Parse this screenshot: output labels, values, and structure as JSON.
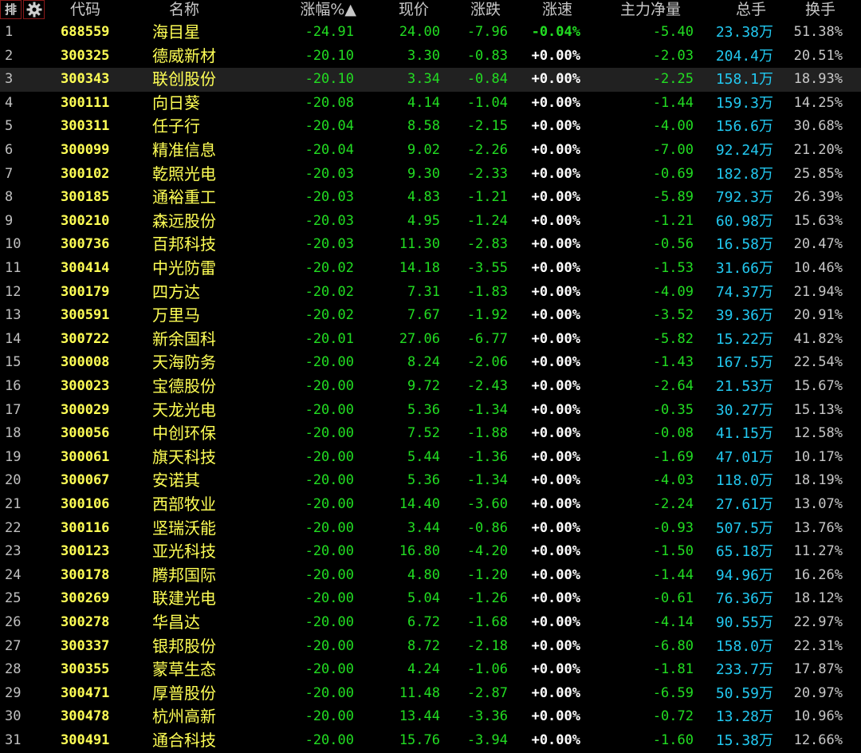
{
  "header": {
    "rank_icon_label": "排",
    "settings_icon": "gear-icon",
    "columns": [
      "代码",
      "名称",
      "涨幅%",
      "现价",
      "涨跌",
      "涨速",
      "主力净量",
      "总手",
      "换手"
    ],
    "sort_indicator": "▲"
  },
  "colors": {
    "background": "#000000",
    "code": "#ffff55",
    "name": "#ffff55",
    "down": "#22dd22",
    "volume": "#22c8f0",
    "speed": "#ffffff",
    "selected_row": "#212121"
  },
  "selected_row_index": 2,
  "rows": [
    {
      "idx": "1",
      "code": "688559",
      "name": "海目星",
      "pct": "-24.91",
      "price": "24.00",
      "chg": "-7.96",
      "speed": "-0.04%",
      "net": "-5.40",
      "vol": "23.38",
      "vol_unit": "万",
      "turn": "51.38%"
    },
    {
      "idx": "2",
      "code": "300325",
      "name": "德威新材",
      "pct": "-20.10",
      "price": "3.30",
      "chg": "-0.83",
      "speed": "+0.00%",
      "net": "-2.03",
      "vol": "204.4",
      "vol_unit": "万",
      "turn": "20.51%"
    },
    {
      "idx": "3",
      "code": "300343",
      "name": "联创股份",
      "pct": "-20.10",
      "price": "3.34",
      "chg": "-0.84",
      "speed": "+0.00%",
      "net": "-2.25",
      "vol": "158.1",
      "vol_unit": "万",
      "turn": "18.93%"
    },
    {
      "idx": "4",
      "code": "300111",
      "name": "向日葵",
      "pct": "-20.08",
      "price": "4.14",
      "chg": "-1.04",
      "speed": "+0.00%",
      "net": "-1.44",
      "vol": "159.3",
      "vol_unit": "万",
      "turn": "14.25%"
    },
    {
      "idx": "5",
      "code": "300311",
      "name": "任子行",
      "pct": "-20.04",
      "price": "8.58",
      "chg": "-2.15",
      "speed": "+0.00%",
      "net": "-4.00",
      "vol": "156.6",
      "vol_unit": "万",
      "turn": "30.68%"
    },
    {
      "idx": "6",
      "code": "300099",
      "name": "精准信息",
      "pct": "-20.04",
      "price": "9.02",
      "chg": "-2.26",
      "speed": "+0.00%",
      "net": "-7.00",
      "vol": "92.24",
      "vol_unit": "万",
      "turn": "21.20%"
    },
    {
      "idx": "7",
      "code": "300102",
      "name": "乾照光电",
      "pct": "-20.03",
      "price": "9.30",
      "chg": "-2.33",
      "speed": "+0.00%",
      "net": "-0.69",
      "vol": "182.8",
      "vol_unit": "万",
      "turn": "25.85%"
    },
    {
      "idx": "8",
      "code": "300185",
      "name": "通裕重工",
      "pct": "-20.03",
      "price": "4.83",
      "chg": "-1.21",
      "speed": "+0.00%",
      "net": "-5.89",
      "vol": "792.3",
      "vol_unit": "万",
      "turn": "26.39%"
    },
    {
      "idx": "9",
      "code": "300210",
      "name": "森远股份",
      "pct": "-20.03",
      "price": "4.95",
      "chg": "-1.24",
      "speed": "+0.00%",
      "net": "-1.21",
      "vol": "60.98",
      "vol_unit": "万",
      "turn": "15.63%"
    },
    {
      "idx": "10",
      "code": "300736",
      "name": "百邦科技",
      "pct": "-20.03",
      "price": "11.30",
      "chg": "-2.83",
      "speed": "+0.00%",
      "net": "-0.56",
      "vol": "16.58",
      "vol_unit": "万",
      "turn": "20.47%"
    },
    {
      "idx": "11",
      "code": "300414",
      "name": "中光防雷",
      "pct": "-20.02",
      "price": "14.18",
      "chg": "-3.55",
      "speed": "+0.00%",
      "net": "-1.53",
      "vol": "31.66",
      "vol_unit": "万",
      "turn": "10.46%"
    },
    {
      "idx": "12",
      "code": "300179",
      "name": "四方达",
      "pct": "-20.02",
      "price": "7.31",
      "chg": "-1.83",
      "speed": "+0.00%",
      "net": "-4.09",
      "vol": "74.37",
      "vol_unit": "万",
      "turn": "21.94%"
    },
    {
      "idx": "13",
      "code": "300591",
      "name": "万里马",
      "pct": "-20.02",
      "price": "7.67",
      "chg": "-1.92",
      "speed": "+0.00%",
      "net": "-3.52",
      "vol": "39.36",
      "vol_unit": "万",
      "turn": "20.91%"
    },
    {
      "idx": "14",
      "code": "300722",
      "name": "新余国科",
      "pct": "-20.01",
      "price": "27.06",
      "chg": "-6.77",
      "speed": "+0.00%",
      "net": "-5.82",
      "vol": "15.22",
      "vol_unit": "万",
      "turn": "41.82%"
    },
    {
      "idx": "15",
      "code": "300008",
      "name": "天海防务",
      "pct": "-20.00",
      "price": "8.24",
      "chg": "-2.06",
      "speed": "+0.00%",
      "net": "-1.43",
      "vol": "167.5",
      "vol_unit": "万",
      "turn": "22.54%"
    },
    {
      "idx": "16",
      "code": "300023",
      "name": "宝德股份",
      "pct": "-20.00",
      "price": "9.72",
      "chg": "-2.43",
      "speed": "+0.00%",
      "net": "-2.64",
      "vol": "21.53",
      "vol_unit": "万",
      "turn": "15.67%"
    },
    {
      "idx": "17",
      "code": "300029",
      "name": "天龙光电",
      "pct": "-20.00",
      "price": "5.36",
      "chg": "-1.34",
      "speed": "+0.00%",
      "net": "-0.35",
      "vol": "30.27",
      "vol_unit": "万",
      "turn": "15.13%"
    },
    {
      "idx": "18",
      "code": "300056",
      "name": "中创环保",
      "pct": "-20.00",
      "price": "7.52",
      "chg": "-1.88",
      "speed": "+0.00%",
      "net": "-0.08",
      "vol": "41.15",
      "vol_unit": "万",
      "turn": "12.58%"
    },
    {
      "idx": "19",
      "code": "300061",
      "name": "旗天科技",
      "pct": "-20.00",
      "price": "5.44",
      "chg": "-1.36",
      "speed": "+0.00%",
      "net": "-1.69",
      "vol": "47.01",
      "vol_unit": "万",
      "turn": "10.17%"
    },
    {
      "idx": "20",
      "code": "300067",
      "name": "安诺其",
      "pct": "-20.00",
      "price": "5.36",
      "chg": "-1.34",
      "speed": "+0.00%",
      "net": "-4.03",
      "vol": "118.0",
      "vol_unit": "万",
      "turn": "18.19%"
    },
    {
      "idx": "21",
      "code": "300106",
      "name": "西部牧业",
      "pct": "-20.00",
      "price": "14.40",
      "chg": "-3.60",
      "speed": "+0.00%",
      "net": "-2.24",
      "vol": "27.61",
      "vol_unit": "万",
      "turn": "13.07%"
    },
    {
      "idx": "22",
      "code": "300116",
      "name": "坚瑞沃能",
      "pct": "-20.00",
      "price": "3.44",
      "chg": "-0.86",
      "speed": "+0.00%",
      "net": "-0.93",
      "vol": "507.5",
      "vol_unit": "万",
      "turn": "13.76%"
    },
    {
      "idx": "23",
      "code": "300123",
      "name": "亚光科技",
      "pct": "-20.00",
      "price": "16.80",
      "chg": "-4.20",
      "speed": "+0.00%",
      "net": "-1.50",
      "vol": "65.18",
      "vol_unit": "万",
      "turn": "11.27%"
    },
    {
      "idx": "24",
      "code": "300178",
      "name": "腾邦国际",
      "pct": "-20.00",
      "price": "4.80",
      "chg": "-1.20",
      "speed": "+0.00%",
      "net": "-1.44",
      "vol": "94.96",
      "vol_unit": "万",
      "turn": "16.26%"
    },
    {
      "idx": "25",
      "code": "300269",
      "name": "联建光电",
      "pct": "-20.00",
      "price": "5.04",
      "chg": "-1.26",
      "speed": "+0.00%",
      "net": "-0.61",
      "vol": "76.36",
      "vol_unit": "万",
      "turn": "18.12%"
    },
    {
      "idx": "26",
      "code": "300278",
      "name": "华昌达",
      "pct": "-20.00",
      "price": "6.72",
      "chg": "-1.68",
      "speed": "+0.00%",
      "net": "-4.14",
      "vol": "90.55",
      "vol_unit": "万",
      "turn": "22.97%"
    },
    {
      "idx": "27",
      "code": "300337",
      "name": "银邦股份",
      "pct": "-20.00",
      "price": "8.72",
      "chg": "-2.18",
      "speed": "+0.00%",
      "net": "-6.80",
      "vol": "158.0",
      "vol_unit": "万",
      "turn": "22.31%"
    },
    {
      "idx": "28",
      "code": "300355",
      "name": "蒙草生态",
      "pct": "-20.00",
      "price": "4.24",
      "chg": "-1.06",
      "speed": "+0.00%",
      "net": "-1.81",
      "vol": "233.7",
      "vol_unit": "万",
      "turn": "17.87%"
    },
    {
      "idx": "29",
      "code": "300471",
      "name": "厚普股份",
      "pct": "-20.00",
      "price": "11.48",
      "chg": "-2.87",
      "speed": "+0.00%",
      "net": "-6.59",
      "vol": "50.59",
      "vol_unit": "万",
      "turn": "20.97%"
    },
    {
      "idx": "30",
      "code": "300478",
      "name": "杭州高新",
      "pct": "-20.00",
      "price": "13.44",
      "chg": "-3.36",
      "speed": "+0.00%",
      "net": "-0.72",
      "vol": "13.28",
      "vol_unit": "万",
      "turn": "10.96%"
    },
    {
      "idx": "31",
      "code": "300491",
      "name": "通合科技",
      "pct": "-20.00",
      "price": "15.76",
      "chg": "-3.94",
      "speed": "+0.00%",
      "net": "-1.60",
      "vol": "15.38",
      "vol_unit": "万",
      "turn": "12.66%"
    }
  ]
}
